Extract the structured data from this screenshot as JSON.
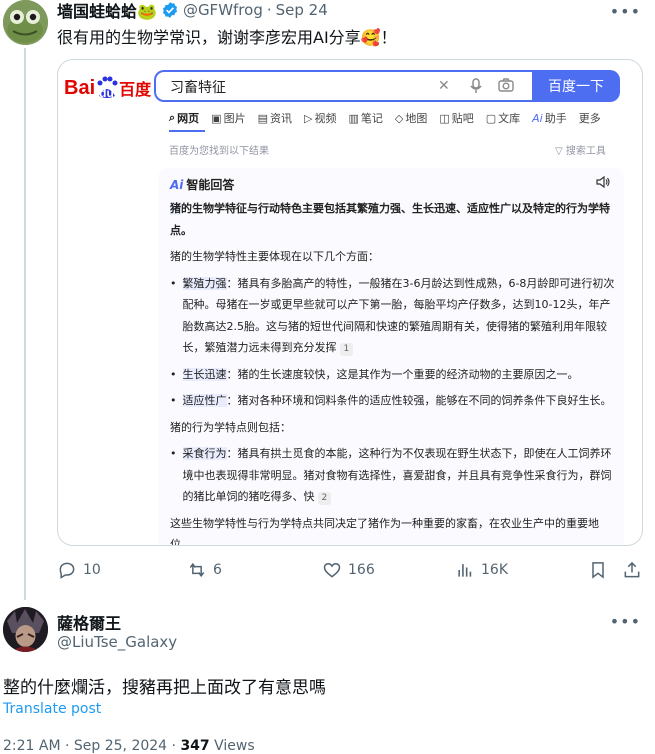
{
  "tweet": {
    "display_name": "墙国蛙蛤蛤🐸",
    "handle": "@GFWfrog",
    "separator": "·",
    "date": "Sep 24",
    "text": "很有用的生物学常识，谢谢李彦宏用AI分享🥰！",
    "more_icon": "more-horizontal-icon"
  },
  "baidu": {
    "logo_text_bai": "Bai",
    "logo_text_du": "du",
    "logo_text_cn": "百度",
    "query": "习畜特征",
    "search_button": "百度一下",
    "tabs": [
      "网页",
      "图片",
      "资讯",
      "视频",
      "笔记",
      "地图",
      "贴吧",
      "文库",
      "助手",
      "更多"
    ],
    "result_hint": "百度为您找到以下结果",
    "search_tools": "搜索工具",
    "ai": {
      "title": "智能回答",
      "ai_mark": "Ai",
      "intro_keyword": "猪",
      "intro_rest": "的生物学特征与行动特色主要包括其繁殖力强、生长迅速、适应性广以及特定的行为学特点。",
      "section1": "猪的生物学特性主要体现在以下几个方面：",
      "bullet1_label": "繁殖力强",
      "bullet1_text": "：猪具有多胎高产的特性，一般猪在3-6月龄达到性成熟，6-8月龄即可进行初次配种。母猪在一岁或更早些就可以产下第一胎，每胎平均产仔数多，达到10-12头，年产胎数高达2.5胎。这与猪的短世代间隔和快速的繁殖周期有关，使得猪的繁殖利用年限较长，繁殖潜力远未得到充分发挥",
      "bullet1_ref": "1",
      "bullet2_label": "生长迅速",
      "bullet2_text": "：猪的生长速度较快，这是其作为一个重要的经济动物的主要原因之一。",
      "bullet3_label": "适应性广",
      "bullet3_text": "：猪对各种环境和饲料条件的适应性较强，能够在不同的饲养条件下良好生长。",
      "section2": "猪的行为学特点则包括：",
      "bullet4_label": "采食行为",
      "bullet4_text": "：猪具有拱土觅食的本能，这种行为不仅表现在野生状态下，即使在人工饲养环境中也表现得非常明显。猪对食物有选择性，喜爱甜食，并且具有竞争性采食行为，群饲的猪比单饲的猪吃得多、快",
      "bullet4_ref": "2",
      "conclusion": "这些生物学特性与行为学特点共同决定了猪作为一种重要的家畜，在农业生产中的重要地位。"
    }
  },
  "actions": {
    "replies": "10",
    "reposts": "6",
    "likes": "166",
    "views": "16K"
  },
  "reply": {
    "display_name": "薩格爾王",
    "handle": "@LiuTse_Galaxy",
    "text": "整的什麼爛活，搜豬再把上面改了有意思嗎",
    "translate": "Translate post",
    "time": "2:21 AM · Sep 25, 2024 · ",
    "views_count": "347",
    "views_label": " Views"
  },
  "colors": {
    "twitter_blue": "#1d9bf0",
    "baidu_blue": "#4e6ef2",
    "baidu_red": "#e10601",
    "secondary_text": "#536471"
  }
}
